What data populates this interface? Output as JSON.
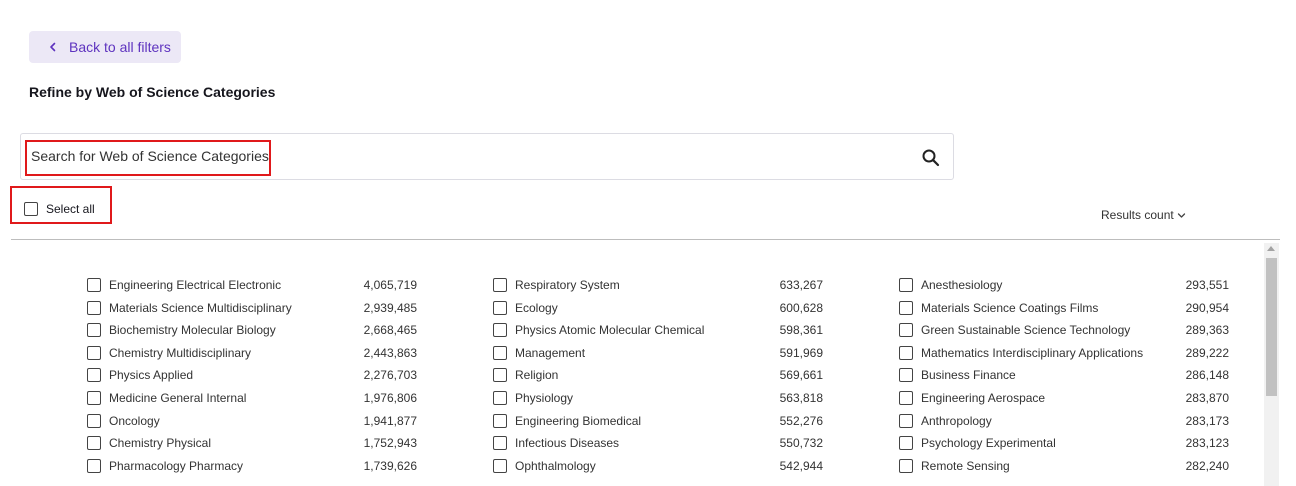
{
  "nav": {
    "back_label": "Back to all filters"
  },
  "page": {
    "title": "Refine by Web of Science Categories"
  },
  "search": {
    "placeholder": "Search for Web of Science Categories",
    "value": ""
  },
  "select_all": {
    "label": "Select all",
    "checked": false
  },
  "sort": {
    "label": "Results count"
  },
  "colors": {
    "accent": "#5e33bf",
    "back_bg": "#ece8f6",
    "highlight": "#e0191b"
  },
  "icons": {
    "back": "chevron-left-icon",
    "search": "search-icon",
    "sort": "chevron-down-icon"
  },
  "columns": [
    [
      {
        "label": "Engineering Electrical Electronic",
        "count": "4,065,719"
      },
      {
        "label": "Materials Science Multidisciplinary",
        "count": "2,939,485"
      },
      {
        "label": "Biochemistry Molecular Biology",
        "count": "2,668,465"
      },
      {
        "label": "Chemistry Multidisciplinary",
        "count": "2,443,863"
      },
      {
        "label": "Physics Applied",
        "count": "2,276,703"
      },
      {
        "label": "Medicine General Internal",
        "count": "1,976,806"
      },
      {
        "label": "Oncology",
        "count": "1,941,877"
      },
      {
        "label": "Chemistry Physical",
        "count": "1,752,943"
      },
      {
        "label": "Pharmacology Pharmacy",
        "count": "1,739,626"
      }
    ],
    [
      {
        "label": "Respiratory System",
        "count": "633,267"
      },
      {
        "label": "Ecology",
        "count": "600,628"
      },
      {
        "label": "Physics Atomic Molecular Chemical",
        "count": "598,361"
      },
      {
        "label": "Management",
        "count": "591,969"
      },
      {
        "label": "Religion",
        "count": "569,661"
      },
      {
        "label": "Physiology",
        "count": "563,818"
      },
      {
        "label": "Engineering Biomedical",
        "count": "552,276"
      },
      {
        "label": "Infectious Diseases",
        "count": "550,732"
      },
      {
        "label": "Ophthalmology",
        "count": "542,944"
      }
    ],
    [
      {
        "label": "Anesthesiology",
        "count": "293,551"
      },
      {
        "label": "Materials Science Coatings Films",
        "count": "290,954"
      },
      {
        "label": "Green Sustainable Science Technology",
        "count": "289,363"
      },
      {
        "label": "Mathematics Interdisciplinary Applications",
        "count": "289,222"
      },
      {
        "label": "Business Finance",
        "count": "286,148"
      },
      {
        "label": "Engineering Aerospace",
        "count": "283,870"
      },
      {
        "label": "Anthropology",
        "count": "283,173"
      },
      {
        "label": "Psychology Experimental",
        "count": "283,123"
      },
      {
        "label": "Remote Sensing",
        "count": "282,240"
      }
    ]
  ]
}
